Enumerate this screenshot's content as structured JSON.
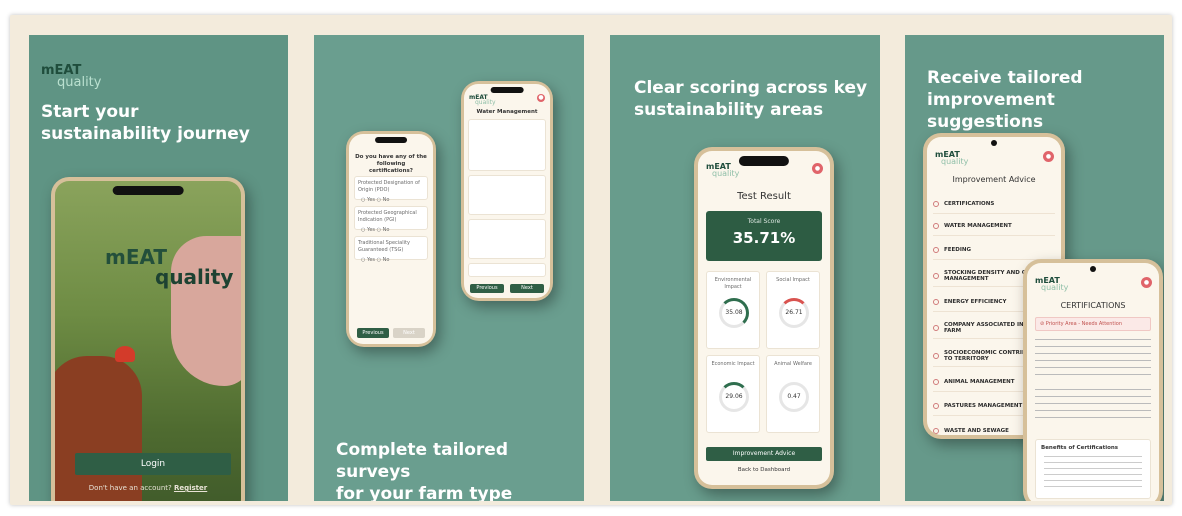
{
  "panels": [
    {
      "brand_top": "mEAT",
      "brand_bottom": "quality",
      "headline_line1": "Start your",
      "headline_line2": "sustainability journey",
      "phone": {
        "logo_top": "mEAT",
        "logo_bottom": "quality",
        "login_label": "Login",
        "register_prompt": "Don't have an account?",
        "register_link": "Register"
      }
    },
    {
      "headline_line1": "Complete tailored surveys",
      "headline_line2": "for your farm type",
      "left_phone": {
        "question": "Do you have any of the following certifications?",
        "items": [
          "Protected Designation of Origin (PDO)",
          "Protected Geographical Indication (PGI)",
          "Traditional Speciality Guaranteed (TSG)"
        ],
        "yes": "Yes",
        "no": "No",
        "previous": "Previous",
        "next": "Next"
      },
      "right_phone": {
        "logo_top": "mEAT",
        "logo_bottom": "quality",
        "section": "Water Management",
        "previous": "Previous",
        "next": "Next"
      }
    },
    {
      "headline_line1": "Clear scoring across key",
      "headline_line2": "sustainability areas",
      "phone": {
        "logo_top": "mEAT",
        "logo_bottom": "quality",
        "title": "Test Result",
        "total_label": "Total Score",
        "total_value": "35.71%",
        "gauges": [
          {
            "label": "Environmental Impact",
            "value": "35.08",
            "color": "#2f6e4e"
          },
          {
            "label": "Social Impact",
            "value": "26.71",
            "color": "#d9534f"
          },
          {
            "label": "Economic Impact",
            "value": "29.06",
            "color": "#2f6e4e"
          },
          {
            "label": "Animal Welfare",
            "value": "0.47",
            "color": "#3b6fd6"
          }
        ],
        "advice_button": "Improvement Advice",
        "back_link": "Back to Dashboard"
      }
    },
    {
      "headline_line1": "Receive tailored",
      "headline_line2": "improvement suggestions",
      "back_phone": {
        "logo_top": "mEAT",
        "logo_bottom": "quality",
        "title": "Improvement Advice",
        "rows": [
          "CERTIFICATIONS",
          "WATER MANAGEMENT",
          "FEEDING",
          "STOCKING DENSITY AND GRAZING MANAGEMENT",
          "ENERGY EFFICIENCY",
          "COMPANY ASSOCIATED IN THE FARM",
          "SOCIOECONOMIC CONTRIBUTION TO TERRITORY",
          "ANIMAL MANAGEMENT",
          "PASTURES MANAGEMENT",
          "WASTE AND SEWAGE"
        ]
      },
      "front_phone": {
        "logo_top": "mEAT",
        "logo_bottom": "quality",
        "title": "CERTIFICATIONS",
        "priority": "Priority Area - Needs Attention",
        "benefits_title": "Benefits of Certifications"
      }
    }
  ]
}
